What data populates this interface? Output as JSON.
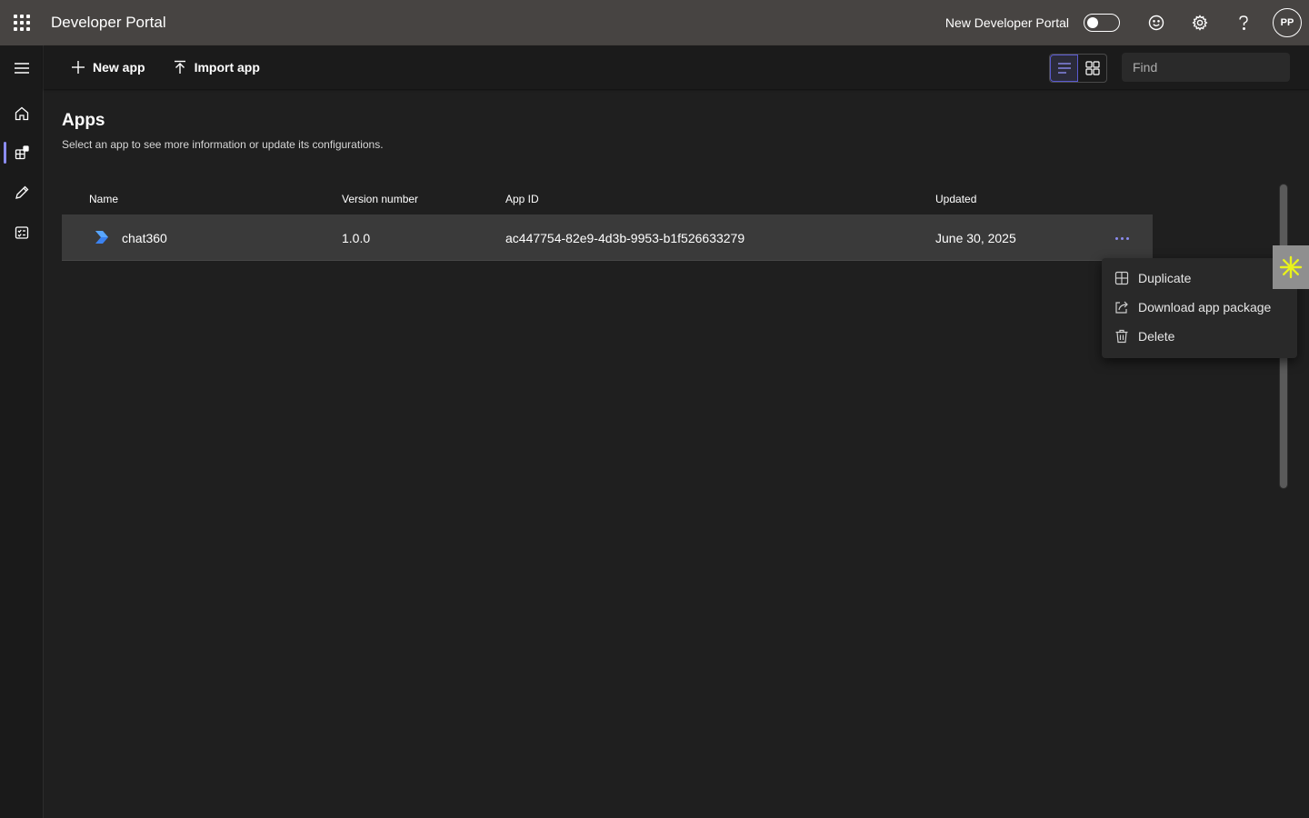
{
  "header": {
    "title": "Developer Portal",
    "new_portal_label": "New Developer Portal",
    "avatar_initials": "PP"
  },
  "rail": {
    "items": [
      {
        "name": "home-icon",
        "active": false
      },
      {
        "name": "apps-icon",
        "active": true
      },
      {
        "name": "tools-icon",
        "active": false
      },
      {
        "name": "checklist-icon",
        "active": false
      }
    ]
  },
  "toolbar": {
    "new_app_label": "New app",
    "import_app_label": "Import app",
    "find_placeholder": "Find"
  },
  "page": {
    "title": "Apps",
    "subtitle": "Select an app to see more information or update its configurations."
  },
  "table": {
    "columns": [
      "Name",
      "Version number",
      "App ID",
      "Updated"
    ],
    "rows": [
      {
        "name": "chat360",
        "version": "1.0.0",
        "app_id": "ac447754-82e9-4d3b-9953-b1f526633279",
        "updated": "June 30, 2025"
      }
    ]
  },
  "context_menu": {
    "items": [
      "Duplicate",
      "Download app package",
      "Delete"
    ]
  },
  "colors": {
    "topbar": "#474442",
    "background": "#1f1f1f",
    "accent": "#8b8cf0",
    "row_selected": "#3a3a3a",
    "widget_star": "#e8f21c"
  }
}
